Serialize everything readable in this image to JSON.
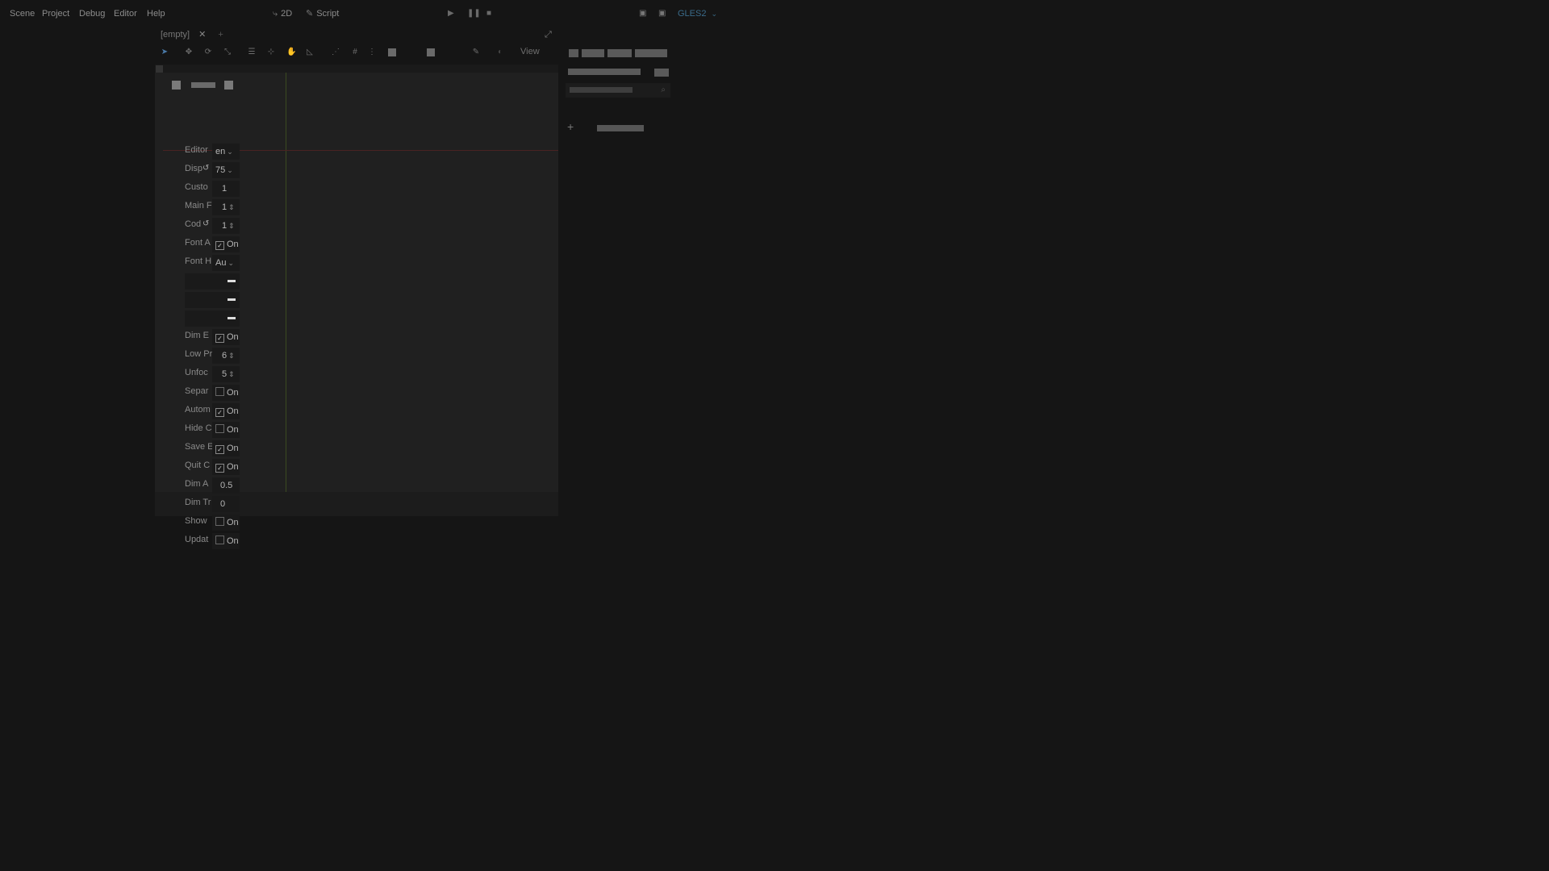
{
  "menu": {
    "items": [
      "Scene",
      "Project",
      "Debug",
      "Editor",
      "Help"
    ]
  },
  "modes": {
    "two_d": "2D",
    "script": "Script"
  },
  "renderer": {
    "label": "GLES2"
  },
  "editor_tab": {
    "title": "[empty]"
  },
  "toolbar": {
    "view_label": "View"
  },
  "settings": {
    "rows": [
      {
        "label": "Editor",
        "value": "en"
      },
      {
        "label": "Disp",
        "value": "75"
      },
      {
        "label": "Custo",
        "value": "1"
      },
      {
        "label": "Main F",
        "value": "1"
      },
      {
        "label": "Cod",
        "value": "1"
      },
      {
        "label": "Font A",
        "value": "On"
      },
      {
        "label": "Font H",
        "value": "Au"
      },
      {
        "label": "Dim E",
        "value": "On"
      },
      {
        "label": "Low Pr",
        "value": "6"
      },
      {
        "label": "Unfoc",
        "value": "5"
      },
      {
        "label": "Separ",
        "value": "On"
      },
      {
        "label": "Autom",
        "value": "On"
      },
      {
        "label": "Hide C",
        "value": "On"
      },
      {
        "label": "Save E",
        "value": "On"
      },
      {
        "label": "Quit C",
        "value": "On"
      },
      {
        "label": "Dim A",
        "value": "0.5"
      },
      {
        "label": "Dim Tr",
        "value": "0"
      },
      {
        "label": "Show",
        "value": "On"
      },
      {
        "label": "Updat",
        "value": "On"
      }
    ],
    "checked": {
      "font_a": true,
      "dim_e": true,
      "separ": false,
      "autom": true,
      "hide_c": false,
      "save_e": true,
      "quit_c": true,
      "show": false,
      "updat": false
    }
  },
  "colors": {
    "background": "#151515",
    "accent_renderer": "#3a6b8a",
    "guide_vertical": "#3b4a20",
    "guide_horizontal": "#4a2323"
  }
}
